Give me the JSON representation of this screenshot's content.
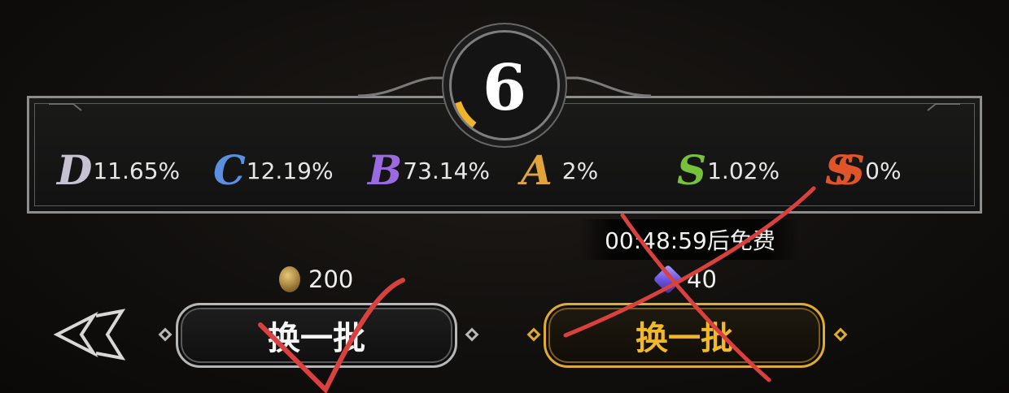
{
  "level": "6",
  "rates": [
    {
      "grade": "D",
      "value": "11.65%",
      "color": "#c6c2d2"
    },
    {
      "grade": "C",
      "value": "12.19%",
      "color": "#5b8fe0"
    },
    {
      "grade": "B",
      "value": "73.14%",
      "color": "#9a6ae0"
    },
    {
      "grade": "A",
      "value": "2%",
      "color": "#e1a43a"
    },
    {
      "grade": "S",
      "value": "1.02%",
      "color": "#77c23a"
    },
    {
      "grade": "SS",
      "value": "0%",
      "color": "#e0542a"
    }
  ],
  "left_option": {
    "cost_icon": "coin-icon",
    "cost": "200",
    "button_label": "换一批"
  },
  "right_option": {
    "timer": "00:48:59后免费",
    "cost_icon": "gem-icon",
    "cost": "40",
    "button_label": "换一批"
  },
  "annotations": {
    "check_color": "#d8413d",
    "cross_color": "#d8413d"
  },
  "colors": {
    "gold": "#e0ac2e",
    "panel_border": "#8d8d8d"
  }
}
